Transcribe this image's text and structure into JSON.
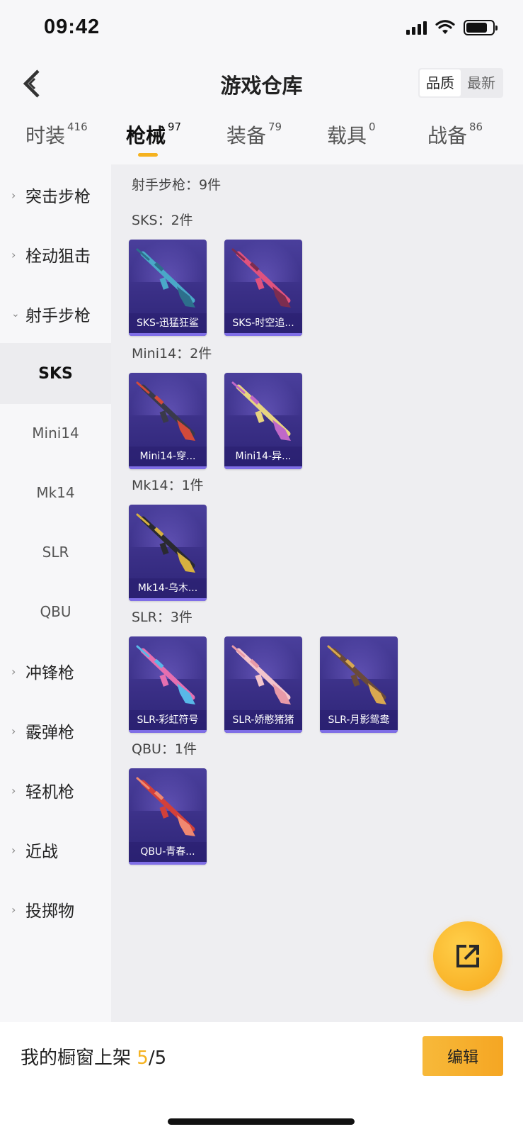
{
  "status_bar": {
    "time": "09:42"
  },
  "header": {
    "title": "游戏仓库",
    "sort_options": [
      "品质",
      "最新"
    ],
    "sort_selected": "品质"
  },
  "tabs": [
    {
      "label": "时装",
      "count": "416"
    },
    {
      "label": "枪械",
      "count": "97",
      "active": true
    },
    {
      "label": "装备",
      "count": "79"
    },
    {
      "label": "载具",
      "count": "0"
    },
    {
      "label": "战备",
      "count": "86"
    }
  ],
  "sidebar": {
    "items": [
      {
        "label": "突击步枪"
      },
      {
        "label": "栓动狙击"
      },
      {
        "label": "射手步枪",
        "expanded": true,
        "children": [
          "SKS",
          "Mini14",
          "Mk14",
          "SLR",
          "QBU"
        ],
        "selected_child": "SKS"
      },
      {
        "label": "冲锋枪"
      },
      {
        "label": "霰弹枪"
      },
      {
        "label": "轻机枪"
      },
      {
        "label": "近战"
      },
      {
        "label": "投掷物"
      }
    ]
  },
  "content": {
    "category_header": "射手步枪：9件",
    "groups": [
      {
        "header": "SKS：2件",
        "items": [
          {
            "name": "SKS-迅猛狂鲨",
            "gun_color": "#4aa8c8",
            "accent": "#2d6f8c"
          },
          {
            "name": "SKS-时空追...",
            "gun_color": "#e0527e",
            "accent": "#7c2d50"
          }
        ]
      },
      {
        "header": "Mini14：2件",
        "items": [
          {
            "name": "Mini14-穿...",
            "gun_color": "#3a3a4a",
            "accent": "#d24a3a"
          },
          {
            "name": "Mini14-异...",
            "gun_color": "#e8d480",
            "accent": "#c068c8"
          }
        ]
      },
      {
        "header": "Mk14：1件",
        "items": [
          {
            "name": "Mk14-乌木...",
            "gun_color": "#2a2a30",
            "accent": "#d6b040"
          }
        ]
      },
      {
        "header": "SLR：3件",
        "items": [
          {
            "name": "SLR-彩虹符号",
            "gun_color": "#e66fb0",
            "accent": "#58b8e8"
          },
          {
            "name": "SLR-娇憨猪猪",
            "gun_color": "#f3c4cc",
            "accent": "#e89aa8"
          },
          {
            "name": "SLR-月影鸳鸯",
            "gun_color": "#6a4a3a",
            "accent": "#d8a850"
          }
        ]
      },
      {
        "header": "QBU：1件",
        "items": [
          {
            "name": "QBU-青春...",
            "gun_color": "#d2403a",
            "accent": "#f08870"
          }
        ]
      }
    ]
  },
  "bottom_bar": {
    "label": "我的橱窗上架",
    "count_current": "5",
    "count_total": "/5",
    "edit_label": "编辑"
  }
}
